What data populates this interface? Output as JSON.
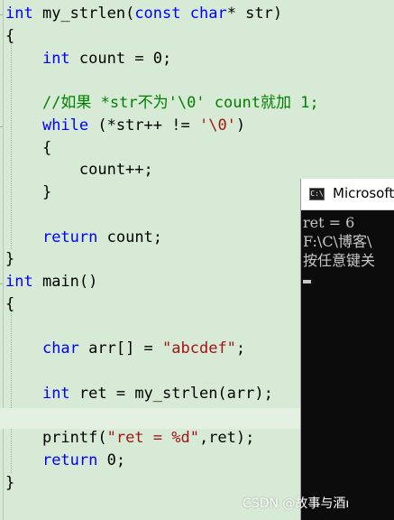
{
  "editor": {
    "lines": [
      {
        "parts": [
          {
            "t": "kw",
            "v": "int"
          },
          {
            "t": "p",
            "v": " my_strlen("
          },
          {
            "t": "kw",
            "v": "const"
          },
          {
            "t": "p",
            "v": " "
          },
          {
            "t": "kw",
            "v": "char"
          },
          {
            "t": "p",
            "v": "* str)"
          }
        ]
      },
      {
        "parts": [
          {
            "t": "p",
            "v": "{"
          }
        ]
      },
      {
        "parts": [
          {
            "t": "p",
            "v": "    "
          },
          {
            "t": "kw",
            "v": "int"
          },
          {
            "t": "p",
            "v": " count = 0;"
          }
        ]
      },
      {
        "parts": [
          {
            "t": "p",
            "v": ""
          }
        ]
      },
      {
        "parts": [
          {
            "t": "p",
            "v": "    "
          },
          {
            "t": "cm",
            "v": "//如果 *str不为'\\0' count就加 1;"
          }
        ]
      },
      {
        "parts": [
          {
            "t": "p",
            "v": "    "
          },
          {
            "t": "kw",
            "v": "while"
          },
          {
            "t": "p",
            "v": " (*str++ != "
          },
          {
            "t": "str",
            "v": "'\\0'"
          },
          {
            "t": "p",
            "v": ")"
          }
        ]
      },
      {
        "parts": [
          {
            "t": "p",
            "v": "    {"
          }
        ]
      },
      {
        "parts": [
          {
            "t": "p",
            "v": "        count++;"
          }
        ]
      },
      {
        "parts": [
          {
            "t": "p",
            "v": "    }"
          }
        ]
      },
      {
        "parts": [
          {
            "t": "p",
            "v": ""
          }
        ]
      },
      {
        "parts": [
          {
            "t": "p",
            "v": "    "
          },
          {
            "t": "kw",
            "v": "return"
          },
          {
            "t": "p",
            "v": " count;"
          }
        ]
      },
      {
        "parts": [
          {
            "t": "p",
            "v": "}"
          }
        ]
      },
      {
        "parts": [
          {
            "t": "kw",
            "v": "int"
          },
          {
            "t": "p",
            "v": " main()"
          }
        ]
      },
      {
        "parts": [
          {
            "t": "p",
            "v": "{"
          }
        ]
      },
      {
        "parts": [
          {
            "t": "p",
            "v": ""
          }
        ]
      },
      {
        "parts": [
          {
            "t": "p",
            "v": "    "
          },
          {
            "t": "kw",
            "v": "char"
          },
          {
            "t": "p",
            "v": " arr[] = "
          },
          {
            "t": "str",
            "v": "\"abcdef\""
          },
          {
            "t": "p",
            "v": ";"
          }
        ]
      },
      {
        "parts": [
          {
            "t": "p",
            "v": ""
          }
        ]
      },
      {
        "parts": [
          {
            "t": "p",
            "v": "    "
          },
          {
            "t": "kw",
            "v": "int"
          },
          {
            "t": "p",
            "v": " ret = my_strlen(arr);"
          }
        ]
      },
      {
        "parts": [
          {
            "t": "p",
            "v": ""
          }
        ]
      },
      {
        "parts": [
          {
            "t": "p",
            "v": "    printf("
          },
          {
            "t": "str",
            "v": "\"ret = %d\""
          },
          {
            "t": "p",
            "v": ",ret);"
          }
        ]
      },
      {
        "parts": [
          {
            "t": "p",
            "v": "    "
          },
          {
            "t": "kw",
            "v": "return"
          },
          {
            "t": "p",
            "v": " 0;"
          }
        ]
      },
      {
        "parts": [
          {
            "t": "p",
            "v": "}"
          }
        ]
      }
    ]
  },
  "console": {
    "title": "Microsoft",
    "icon_label": "C:\\",
    "lines": [
      "ret = 6",
      "F:\\C\\博客\\",
      "按任意键关"
    ]
  },
  "watermark": "CSDN @故事与酒ו",
  "colors": {
    "editor_bg": "#d7ead5",
    "keyword": "#0000ff",
    "string": "#a31515",
    "comment": "#008000",
    "console_bg": "#0c0c0c",
    "console_text": "#c8c8c8"
  }
}
